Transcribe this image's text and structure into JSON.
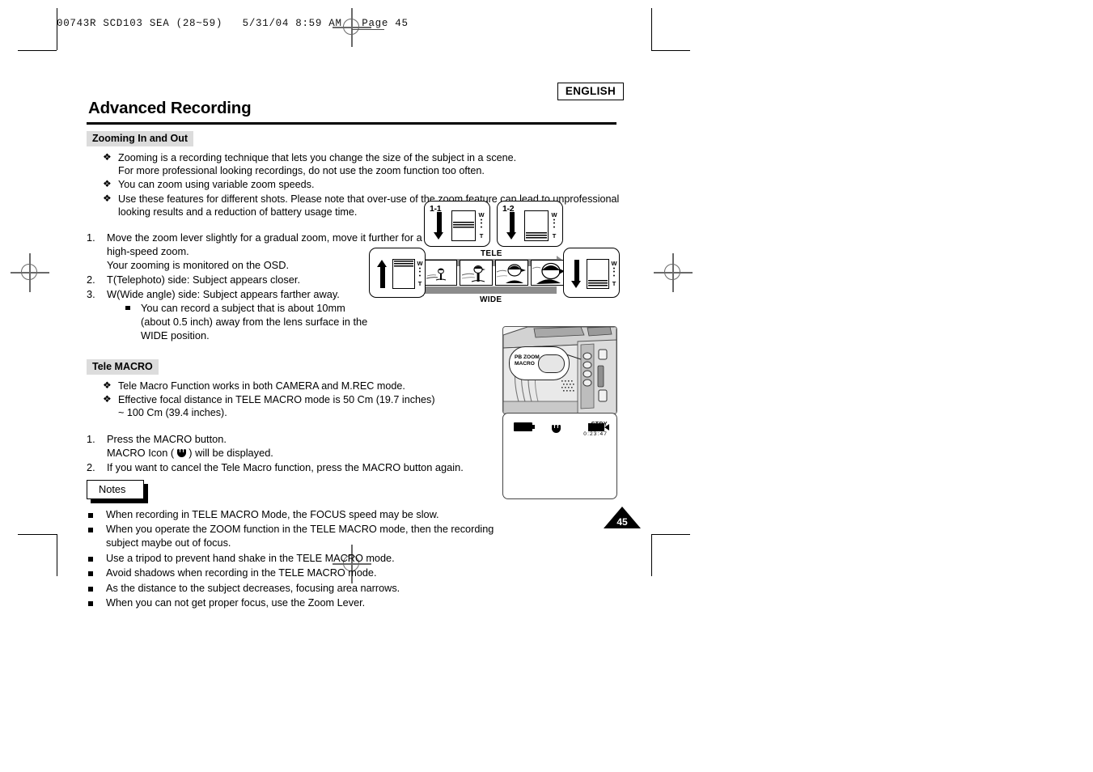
{
  "print_header": {
    "text": "00743R SCD103 SEA (28~59)   5/31/04 8:59 AM   Page 45"
  },
  "badge": {
    "language": "ENGLISH"
  },
  "page_title": "Advanced Recording",
  "page_number": "45",
  "sections": [
    {
      "heading": "Zooming In and Out",
      "club_bullets": [
        "Zooming is a recording technique that lets you change the size of the subject in a scene.",
        "For more professional looking recordings, do not use the zoom function too often.",
        "You can zoom using variable zoom speeds.",
        "Use these features for different shots. Please note that over-use of the zoom feature can lead to unprofessional looking results and a reduction of battery usage time."
      ],
      "numbered": [
        {
          "n": "1.",
          "lines": [
            "Move the zoom lever slightly for a gradual zoom, move it further for a",
            "high-speed zoom.",
            "Your zooming is monitored on the OSD."
          ]
        },
        {
          "n": "2.",
          "lines": [
            "T(Telephoto) side: Subject appears closer."
          ]
        },
        {
          "n": "3.",
          "lines": [
            "W(Wide angle) side: Subject appears farther away."
          ]
        }
      ],
      "sub_bullet": [
        "You can record a subject that is about 10mm",
        "(about 0.5 inch) away from the lens surface in the",
        "WIDE position."
      ]
    },
    {
      "heading": "Tele MACRO",
      "club_bullets": [
        "Tele Macro Function works in both CAMERA and M.REC mode.",
        "Effective focal distance in TELE MACRO mode is 50 Cm (19.7 inches) ~ 100 Cm (39.4 inches)."
      ],
      "numbered": [
        {
          "n": "1.",
          "lines": [
            "Press the MACRO button.",
            "MACRO Icon (  ) will be displayed."
          ]
        },
        {
          "n": "2.",
          "lines": [
            "If you want to cancel the Tele Macro function, press the MACRO button again."
          ]
        }
      ]
    }
  ],
  "macro_step_prefix": "MACRO Icon ( ",
  "macro_step_suffix": " ) will be displayed.",
  "notes": {
    "label": "Notes",
    "items": [
      "When recording in TELE MACRO Mode, the FOCUS speed may be slow.",
      "When you operate the ZOOM function in the TELE MACRO mode, then the recording subject maybe out of focus.",
      "Use a tripod to prevent hand shake in the  TELE MACRO mode.",
      "Avoid shadows when recording in the  TELE MACRO mode.",
      "As the distance to the subject decreases, focusing area narrows.",
      "When you can not get proper focus, use the Zoom Lever."
    ]
  },
  "zoom_diagram": {
    "box_1_1_label": "1-1",
    "box_1_2_label": "1-2",
    "tele_label": "TELE",
    "wide_label": "WIDE",
    "w_label": "W",
    "t_label": "T",
    "dots": ":"
  },
  "camcorder": {
    "callout_line1": "PB ZOOM",
    "callout_line2": "MACRO"
  },
  "osd": {
    "stby": "STBY",
    "timecode": "0:23:47"
  }
}
